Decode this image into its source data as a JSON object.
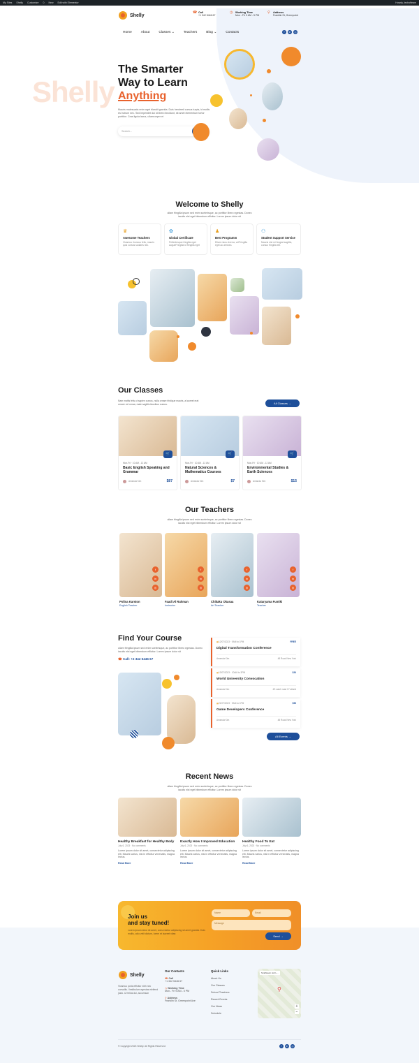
{
  "wp_bar": {
    "items": [
      "My Sites",
      "Shelly",
      "Customize",
      "0",
      "New",
      "Edit with Elementor"
    ],
    "user": "Howdy, techofteam"
  },
  "header": {
    "logo": "Shelly",
    "call_title": "Call",
    "call_value": "+1 342 5446 67",
    "hours_title": "Working Time",
    "hours_value": "Mon - Fri 9 AM - 5 PM",
    "address_title": "Address",
    "address_value": "Franklin St, Greenpoint"
  },
  "nav": {
    "items": [
      "Home",
      "About",
      "Classes",
      "Teachers",
      "Blog",
      "Contacts"
    ]
  },
  "hero": {
    "ghost": "Shelly",
    "line1": "The Smarter",
    "line2": "Way to Learn",
    "accent": "Anything",
    "desc": "Mauris malesuada enim eget blandit gravida. Duis hendrerit cursus turpis, id mollis est rutrum nec. Sed imperdiet dui id libero tincidunt, sit amet elementum tortor porttitor. Cras ligula lacus, ullamcorper et",
    "search_placeholder": "Search..."
  },
  "welcome": {
    "title": "Welcome to Shelly",
    "desc": "ullam fringilla ipsum sed enim scelerisque, ac porttitor libero egestas. Donec iaculis nisi eget bibendum efficitur. Lorem ipsum dolor sit",
    "features": [
      {
        "title": "Awesome Teachers",
        "desc": "Vivamus rhoncus felis, mauris quis cursus sodales nisi."
      },
      {
        "title": "Global Certificate",
        "desc": "Pellentesque fringilla eget augueFringilla id fringilla eget"
      },
      {
        "title": "Best Programm",
        "desc": "Etiam risus viverra, velFringilla eget ac aenean."
      },
      {
        "title": "Student Support Service",
        "desc": "Mauris nisi mi feugiat sagittis, cursus fringilla elit."
      }
    ]
  },
  "classes": {
    "title": "Our Classes",
    "desc": "Nam mattis felis ut sapien cursus, nulla ornare tristique mauris, a laoreet erat ornare vel ornaa, male sagittis faucibus cursus.",
    "btn": "All Classes",
    "items": [
      {
        "meta": "Mon-Fri · 10 AM - 12 AM",
        "title": "Basic English Speaking and Grammar",
        "author": "Amanda Kim",
        "price": "$87"
      },
      {
        "meta": "Mon-Fri · 10 AM - 12 AM",
        "title": "Natural Sciences & Mathematics Courses",
        "author": "Amanda Kim",
        "price": "$7"
      },
      {
        "meta": "Mon-Fri · 10 AM - 12 AM",
        "title": "Environmental Studies & Earth Sciences",
        "author": "Amanda Kim",
        "price": "$15"
      }
    ]
  },
  "teachers": {
    "title": "Our Teachers",
    "desc": "ullam fringilla ipsum sed enim scelerisque, ac porttitor libero egestas. Donec iaculis nisi eget bibendum efficitur. Lorem ipsum dolor sit",
    "items": [
      {
        "name": "Polina Karston",
        "role": "English Teacher"
      },
      {
        "name": "Faadi Al Rahman",
        "role": "Instructor"
      },
      {
        "name": "Chikaku Okasaa",
        "role": "Art Teacher"
      },
      {
        "name": "Kataryama Fumiki",
        "role": "Teacher"
      }
    ]
  },
  "course": {
    "title": "Find Your Course",
    "desc": "ullam fringilla ipsum sed enim scelerisque, ac porttitor libero egestas. Donec iaculis nisi eget bibendum efficitur. Lorem ipsum dolor sit",
    "call": "Call: +2 342 5446 67",
    "btn": "All Events",
    "events": [
      {
        "date": "12/07/2023 · 9AM to 1PM",
        "price": "FREE",
        "title": "Digital Transformation Conference",
        "author": "Amanda Kim",
        "loc": "48 Road New York"
      },
      {
        "date": "13/07/2023 · 10AM to 3PM",
        "price": "$34",
        "title": "World University Convocation",
        "author": "Amanda Kim",
        "loc": "4S satch road 17 atlanti"
      },
      {
        "date": "21/07/2023 · 9AM to 1PM",
        "price": "$56",
        "title": "Game Developers Conference",
        "author": "Amanda Kim",
        "loc": "48 Road New York"
      }
    ]
  },
  "news": {
    "title": "Recent News",
    "desc": "ullam fringilla ipsum sed enim scelerisque, ac porttitor libero egestas. Donec iaculis nisi eget bibendum efficitur. Lorem ipsum dolor sit",
    "read": "Read More",
    "items": [
      {
        "title": "Healthy Breakfast for Healthy Body",
        "meta": "July 6, 2023 · No comments",
        "desc": "Lorem ipsum dolor sit amet, consectetur adipiscing elit. Mauris varius, nisi in efficitur venenatis, magna lectus."
      },
      {
        "title": "Exactly How I Improved Education",
        "meta": "July 6, 2023 · No comments",
        "desc": "Lorem ipsum dolor sit amet, consectetur adipiscing elit. Mauris varius, nisi in efficitur venenatis, magna lectus."
      },
      {
        "title": "Healthy Food To Eat",
        "meta": "July 6, 2023 · No comments",
        "desc": "Lorem ipsum dolor sit amet, consectetur adipiscing elit. Mauris varius, nisi in efficitur venenatis, magna lectus."
      }
    ]
  },
  "subscribe": {
    "line1": "Join us",
    "line2": "and stay tuned!",
    "desc": "Lorem ipsum dolor sit amet, cons ectetur adipiscing sit amet gravida. Duis mollis, odio velit dictum, lorem et laoreet vitae.",
    "name": "Name",
    "email": "Email",
    "message": "Message",
    "send": "Send"
  },
  "footer": {
    "logo": "Shelly",
    "about": "Vivamus porta efficitur nibh nec convallis. Vestibulum egestas eleifend justo. Ut tellus dui, accumsan",
    "contacts_title": "Our Contacts",
    "call_title": "Call",
    "call": "+1 342 5446 67",
    "hours_title": "Working Time",
    "hours": "Mon - Fri 9 AM - 5 PM",
    "addr_title": "Address",
    "addr": "Franklin St, Greenpoint Ave",
    "links_title": "Quick Links",
    "links": [
      "About Us",
      "Our Classes",
      "School Teachers",
      "Recent Events",
      "Our News",
      "Schedule"
    ],
    "map_label": "Smithtown Joh L...",
    "copyright": "© Copyright 2023 Shelly. All Rights Reserved"
  },
  "colors": {
    "accent": "#e8622d",
    "primary": "#1e4f9a",
    "yellow": "#f7b82e"
  }
}
